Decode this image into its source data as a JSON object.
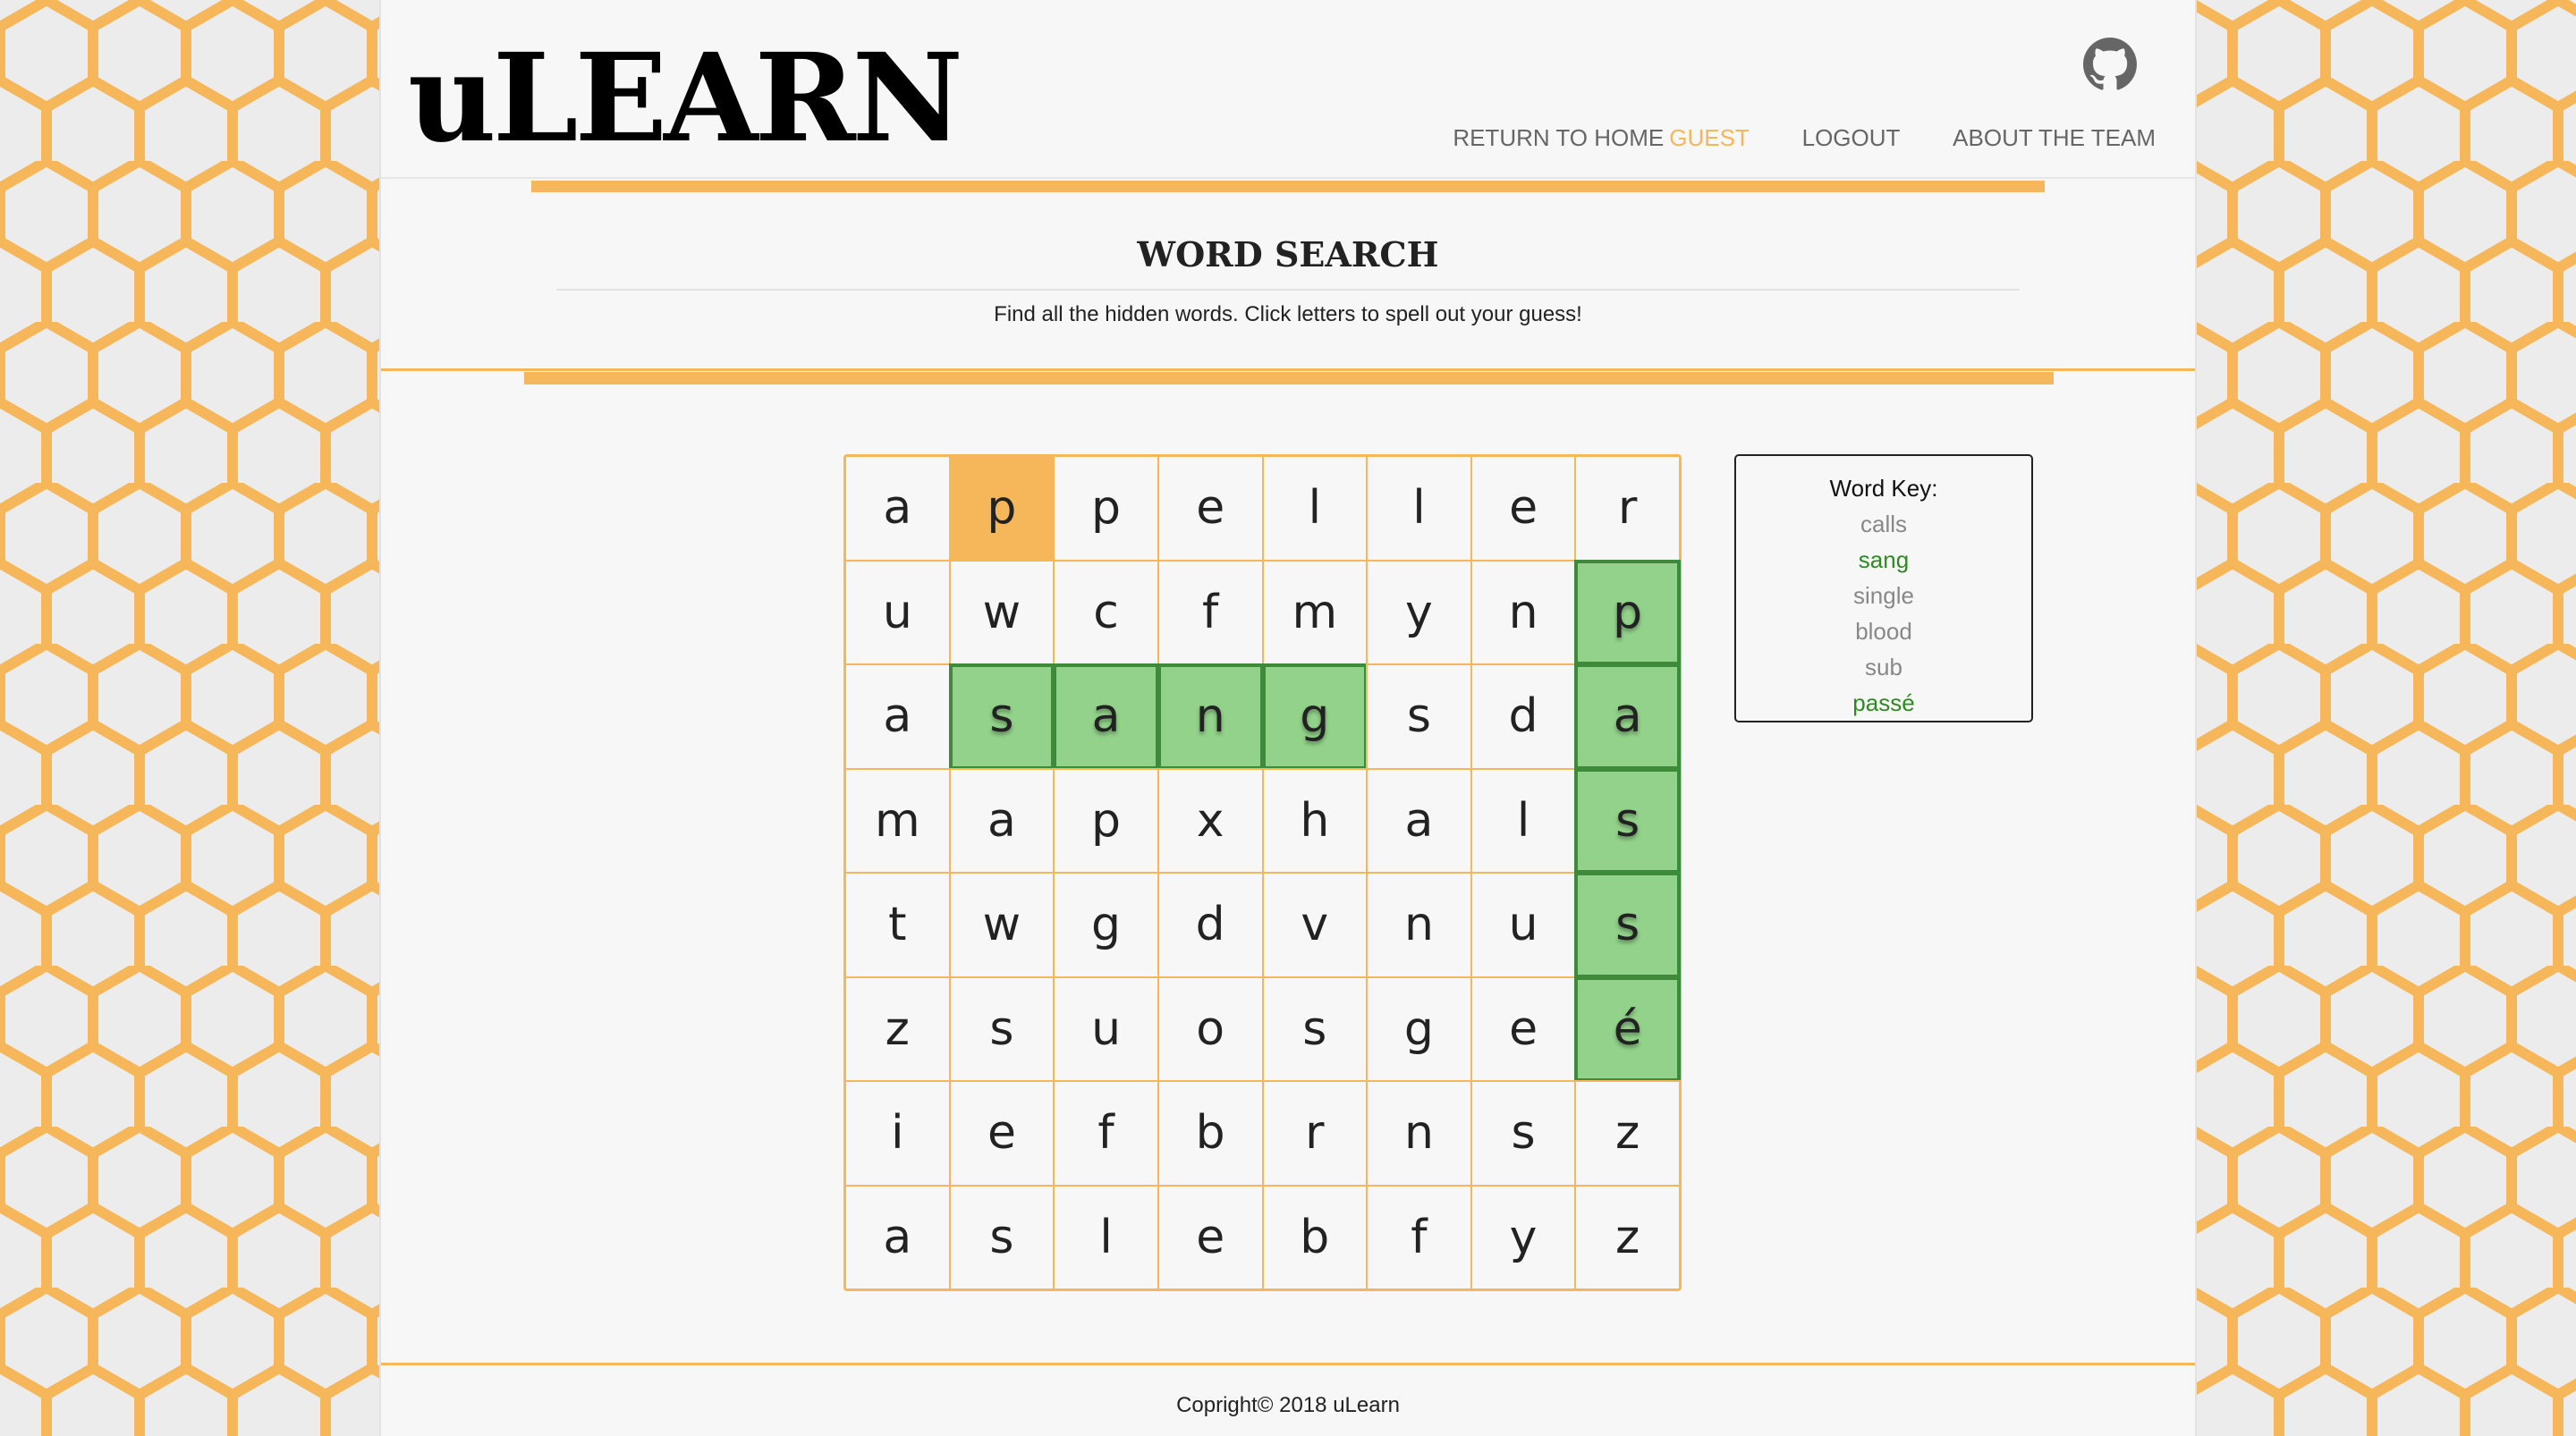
{
  "colors": {
    "accent": "#f5b759",
    "found_fill": "#92d28a",
    "found_border": "#3f8a3a",
    "found_text": "#2e8a22",
    "background": "#ececec",
    "panel": "#f7f7f7"
  },
  "header": {
    "logo": "uLEARN",
    "github_icon": "github-icon",
    "nav": {
      "home": "RETURN TO HOME",
      "guest": "GUEST",
      "logout": "LOGOUT",
      "about": "ABOUT THE TEAM"
    }
  },
  "page": {
    "title": "WORD SEARCH",
    "subtitle": "Find all the hidden words. Click letters to spell out your guess!"
  },
  "grid": {
    "rows": [
      [
        "a",
        "p",
        "p",
        "e",
        "l",
        "l",
        "e",
        "r"
      ],
      [
        "u",
        "w",
        "c",
        "f",
        "m",
        "y",
        "n",
        "p"
      ],
      [
        "a",
        "s",
        "a",
        "n",
        "g",
        "s",
        "d",
        "a"
      ],
      [
        "m",
        "a",
        "p",
        "x",
        "h",
        "a",
        "l",
        "s"
      ],
      [
        "t",
        "w",
        "g",
        "d",
        "v",
        "n",
        "u",
        "s"
      ],
      [
        "z",
        "s",
        "u",
        "o",
        "s",
        "g",
        "e",
        "é"
      ],
      [
        "i",
        "e",
        "f",
        "b",
        "r",
        "n",
        "s",
        "z"
      ],
      [
        "a",
        "s",
        "l",
        "e",
        "b",
        "f",
        "y",
        "z"
      ]
    ],
    "selected_cells": [
      [
        0,
        1
      ]
    ],
    "found_cells": [
      [
        2,
        1
      ],
      [
        2,
        2
      ],
      [
        2,
        3
      ],
      [
        2,
        4
      ],
      [
        1,
        7
      ],
      [
        2,
        7
      ],
      [
        3,
        7
      ],
      [
        4,
        7
      ],
      [
        5,
        7
      ]
    ]
  },
  "word_key": {
    "title": "Word Key:",
    "words": [
      {
        "word": "calls",
        "found": false
      },
      {
        "word": "sang",
        "found": true
      },
      {
        "word": "single",
        "found": false
      },
      {
        "word": "blood",
        "found": false
      },
      {
        "word": "sub",
        "found": false
      },
      {
        "word": "passé",
        "found": true
      }
    ]
  },
  "footer": {
    "copyright": "Copright© 2018 uLearn"
  }
}
